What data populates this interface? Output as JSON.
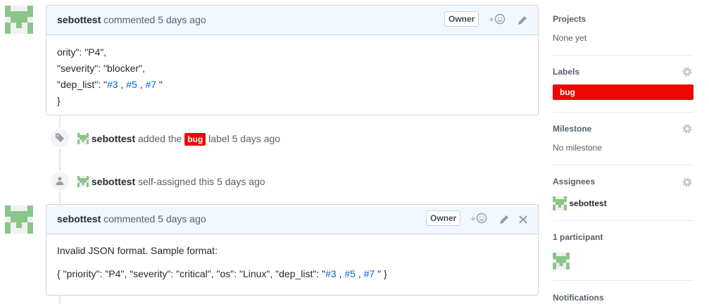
{
  "comments": [
    {
      "author": "sebottest",
      "action": "commented",
      "time": "5 days ago",
      "badge": "Owner",
      "react": "+",
      "lines": {
        "l1": "ority\": \"P4\",",
        "l2": "\"severity\": \"blocker\",",
        "l3_prefix": "\"dep_list\": \"",
        "refs": [
          "#3",
          "#5",
          "#7"
        ],
        "ref_sep": " , ",
        "l3_suffix": " \"",
        "l4": "}"
      }
    },
    {
      "author": "sebottest",
      "action": "commented",
      "time": "5 days ago",
      "badge": "Owner",
      "react": "+",
      "p1": "Invalid JSON format. Sample format:",
      "p2_prefix": "{ \"priority\": \"P4\", \"severity\": \"critical\", \"os\": \"Linux\", \"dep_list\": \"",
      "refs": [
        "#3",
        "#5",
        "#7"
      ],
      "ref_sep": " , ",
      "p2_suffix": " \" }"
    }
  ],
  "events": [
    {
      "author": "sebottest",
      "text_before": "added the",
      "label": "bug",
      "text_after": "label 5 days ago",
      "icon": "tag-icon"
    },
    {
      "author": "sebottest",
      "text": "self-assigned this 5 days ago",
      "icon": "person-icon"
    }
  ],
  "sidebar": {
    "projects": {
      "title": "Projects",
      "value": "None yet"
    },
    "labels": {
      "title": "Labels",
      "items": [
        "bug"
      ]
    },
    "milestone": {
      "title": "Milestone",
      "value": "No milestone"
    },
    "assignees": {
      "title": "Assignees",
      "user": "sebottest"
    },
    "participants": {
      "title": "1 participant"
    },
    "notifications": {
      "title": "Notifications"
    }
  },
  "colors": {
    "label_bug": "#ee0701",
    "link": "#0366d6",
    "header_bg": "#f1f8ff"
  }
}
